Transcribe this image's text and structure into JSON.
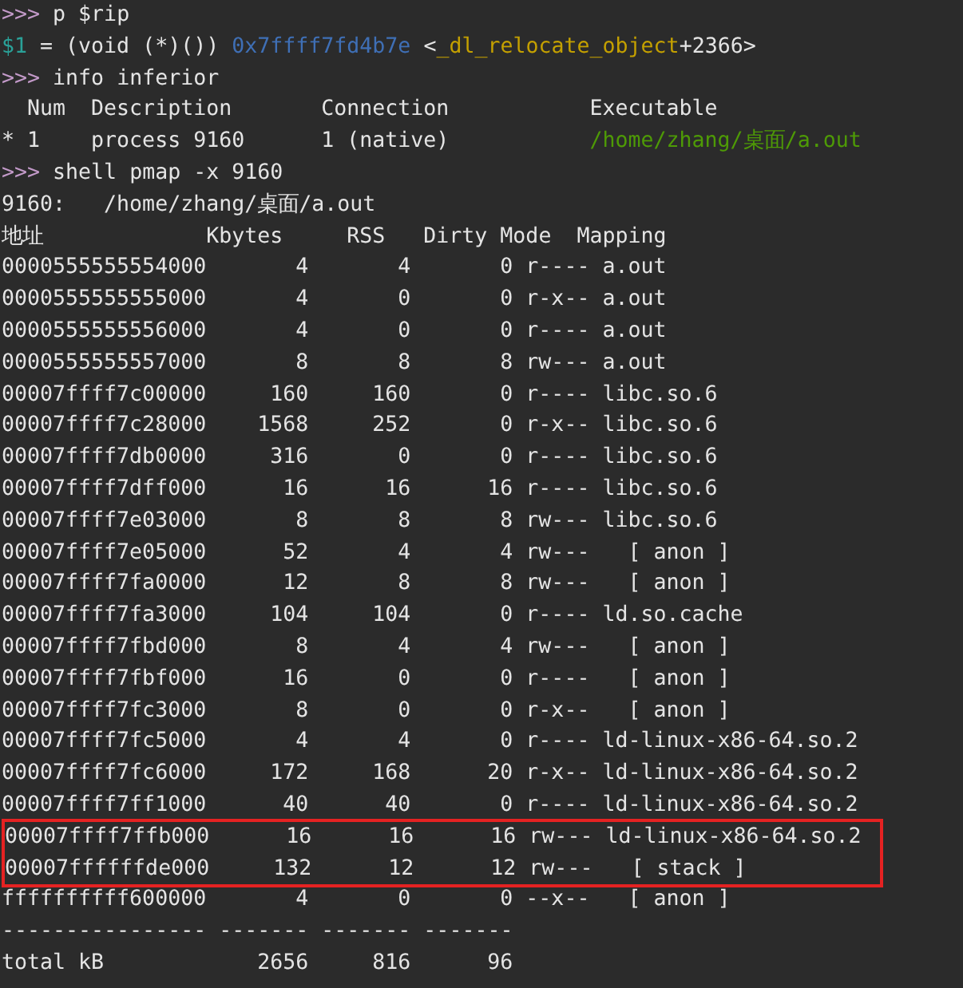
{
  "console": [
    {
      "segments": [
        {
          "kind": "prompt",
          "text": ">>>"
        },
        {
          "kind": "plain",
          "text": " p $rip"
        }
      ]
    },
    {
      "segments": [
        {
          "kind": "var",
          "text": "$1"
        },
        {
          "kind": "plain",
          "text": " = (void (*)()) "
        },
        {
          "kind": "address",
          "text": "0x7ffff7fd4b7e"
        },
        {
          "kind": "plain",
          "text": " <"
        },
        {
          "kind": "symbol",
          "text": "_dl_relocate_object"
        },
        {
          "kind": "plain",
          "text": "+2366>"
        }
      ]
    },
    {
      "segments": [
        {
          "kind": "prompt",
          "text": ">>>"
        },
        {
          "kind": "plain",
          "text": " info inferior"
        }
      ]
    },
    {
      "segments": [
        {
          "kind": "plain",
          "text": "  Num  Description       Connection           Executable"
        }
      ]
    },
    {
      "segments": [
        {
          "kind": "plain",
          "text": "* 1    process 9160      1 (native)           "
        },
        {
          "kind": "path",
          "text": "/home/zhang/桌面/a.out"
        }
      ]
    },
    {
      "segments": [
        {
          "kind": "prompt",
          "text": ">>>"
        },
        {
          "kind": "plain",
          "text": " shell pmap -x 9160"
        }
      ]
    },
    {
      "segments": [
        {
          "kind": "plain",
          "text": "9160:   /home/zhang/桌面/a.out"
        }
      ]
    }
  ],
  "pmap": {
    "columns": [
      "地址",
      "Kbytes",
      "RSS",
      "Dirty",
      "Mode",
      "Mapping"
    ],
    "rows": [
      {
        "address": "0000555555554000",
        "kbytes": "4",
        "rss": "4",
        "dirty": "0",
        "mode": "r----",
        "mapping": "a.out",
        "highlighted": false
      },
      {
        "address": "0000555555555000",
        "kbytes": "4",
        "rss": "0",
        "dirty": "0",
        "mode": "r-x--",
        "mapping": "a.out",
        "highlighted": false
      },
      {
        "address": "0000555555556000",
        "kbytes": "4",
        "rss": "0",
        "dirty": "0",
        "mode": "r----",
        "mapping": "a.out",
        "highlighted": false
      },
      {
        "address": "0000555555557000",
        "kbytes": "8",
        "rss": "8",
        "dirty": "8",
        "mode": "rw---",
        "mapping": "a.out",
        "highlighted": false
      },
      {
        "address": "00007ffff7c00000",
        "kbytes": "160",
        "rss": "160",
        "dirty": "0",
        "mode": "r----",
        "mapping": "libc.so.6",
        "highlighted": false
      },
      {
        "address": "00007ffff7c28000",
        "kbytes": "1568",
        "rss": "252",
        "dirty": "0",
        "mode": "r-x--",
        "mapping": "libc.so.6",
        "highlighted": false
      },
      {
        "address": "00007ffff7db0000",
        "kbytes": "316",
        "rss": "0",
        "dirty": "0",
        "mode": "r----",
        "mapping": "libc.so.6",
        "highlighted": false
      },
      {
        "address": "00007ffff7dff000",
        "kbytes": "16",
        "rss": "16",
        "dirty": "16",
        "mode": "r----",
        "mapping": "libc.so.6",
        "highlighted": false
      },
      {
        "address": "00007ffff7e03000",
        "kbytes": "8",
        "rss": "8",
        "dirty": "8",
        "mode": "rw---",
        "mapping": "libc.so.6",
        "highlighted": false
      },
      {
        "address": "00007ffff7e05000",
        "kbytes": "52",
        "rss": "4",
        "dirty": "4",
        "mode": "rw---",
        "mapping": "  [ anon ]",
        "highlighted": false
      },
      {
        "address": "00007ffff7fa0000",
        "kbytes": "12",
        "rss": "8",
        "dirty": "8",
        "mode": "rw---",
        "mapping": "  [ anon ]",
        "highlighted": false
      },
      {
        "address": "00007ffff7fa3000",
        "kbytes": "104",
        "rss": "104",
        "dirty": "0",
        "mode": "r----",
        "mapping": "ld.so.cache",
        "highlighted": false
      },
      {
        "address": "00007ffff7fbd000",
        "kbytes": "8",
        "rss": "4",
        "dirty": "4",
        "mode": "rw---",
        "mapping": "  [ anon ]",
        "highlighted": false
      },
      {
        "address": "00007ffff7fbf000",
        "kbytes": "16",
        "rss": "0",
        "dirty": "0",
        "mode": "r----",
        "mapping": "  [ anon ]",
        "highlighted": false
      },
      {
        "address": "00007ffff7fc3000",
        "kbytes": "8",
        "rss": "0",
        "dirty": "0",
        "mode": "r-x--",
        "mapping": "  [ anon ]",
        "highlighted": false
      },
      {
        "address": "00007ffff7fc5000",
        "kbytes": "4",
        "rss": "4",
        "dirty": "0",
        "mode": "r----",
        "mapping": "ld-linux-x86-64.so.2",
        "highlighted": false
      },
      {
        "address": "00007ffff7fc6000",
        "kbytes": "172",
        "rss": "168",
        "dirty": "20",
        "mode": "r-x--",
        "mapping": "ld-linux-x86-64.so.2",
        "highlighted": false
      },
      {
        "address": "00007ffff7ff1000",
        "kbytes": "40",
        "rss": "40",
        "dirty": "0",
        "mode": "r----",
        "mapping": "ld-linux-x86-64.so.2",
        "highlighted": false
      },
      {
        "address": "00007ffff7ffb000",
        "kbytes": "16",
        "rss": "16",
        "dirty": "16",
        "mode": "rw---",
        "mapping": "ld-linux-x86-64.so.2",
        "highlighted": true
      },
      {
        "address": "00007ffffffde000",
        "kbytes": "132",
        "rss": "12",
        "dirty": "12",
        "mode": "rw---",
        "mapping": "  [ stack ]",
        "highlighted": true
      },
      {
        "address": "ffffffffff600000",
        "kbytes": "4",
        "rss": "0",
        "dirty": "0",
        "mode": "--x--",
        "mapping": "  [ anon ]",
        "highlighted": false
      }
    ],
    "separator": "---------------- ------- ------- -------",
    "total": {
      "label": "total kB",
      "kbytes": "2656",
      "rss": "816",
      "dirty": "96"
    }
  }
}
